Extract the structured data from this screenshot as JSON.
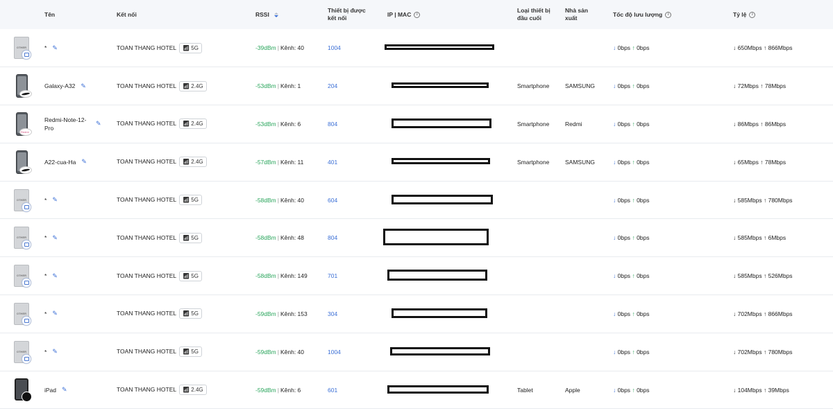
{
  "headers": {
    "name": "Tên",
    "connection": "Kết nối",
    "rssi": "RSSI",
    "connected_line1": "Thiết bị được",
    "connected_line2": "kết nối",
    "ipmac": "IP | MAC",
    "devtype_line1": "Loại thiết bị",
    "devtype_line2": "đầu cuối",
    "maker_line1": "Nhà sản",
    "maker_line2": "xuất",
    "throughput": "Tốc độ lưu lượng",
    "rate": "Tỷ lệ"
  },
  "colors": {
    "accent": "#3b6fd6",
    "green": "#2aa55c",
    "redaction": "#111111"
  },
  "rows": [
    {
      "icon": "other",
      "icon_label": "OTHER",
      "name": "*",
      "ssid": "TOAN THANG HOTEL",
      "band": "5G",
      "rssi": "-39dBm",
      "channel_label": "Kênh: 40",
      "connected": "1004",
      "devtype": "",
      "maker": "",
      "down": "0bps",
      "up": "0bps",
      "rate_down": "650Mbps",
      "rate_up": "866Mbps"
    },
    {
      "icon": "phone-samsung",
      "icon_label": "",
      "name": "Galaxy-A32",
      "ssid": "TOAN THANG HOTEL",
      "band": "2.4G",
      "rssi": "-53dBm",
      "channel_label": "Kênh: 1",
      "connected": "204",
      "devtype": "Smartphone",
      "maker": "SAMSUNG",
      "down": "0bps",
      "up": "0bps",
      "rate_down": "72Mbps",
      "rate_up": "78Mbps"
    },
    {
      "icon": "phone-redmi",
      "icon_label": "",
      "name": "Redmi-Note-12-Pro",
      "ssid": "TOAN THANG HOTEL",
      "band": "2.4G",
      "rssi": "-53dBm",
      "channel_label": "Kênh: 6",
      "connected": "804",
      "devtype": "Smartphone",
      "maker": "Redmi",
      "down": "0bps",
      "up": "0bps",
      "rate_down": "86Mbps",
      "rate_up": "86Mbps"
    },
    {
      "icon": "phone-samsung",
      "icon_label": "",
      "name": "A22-cua-Ha",
      "ssid": "TOAN THANG HOTEL",
      "band": "2.4G",
      "rssi": "-57dBm",
      "channel_label": "Kênh: 11",
      "connected": "401",
      "devtype": "Smartphone",
      "maker": "SAMSUNG",
      "down": "0bps",
      "up": "0bps",
      "rate_down": "65Mbps",
      "rate_up": "78Mbps"
    },
    {
      "icon": "other",
      "icon_label": "OTHER",
      "name": "*",
      "ssid": "TOAN THANG HOTEL",
      "band": "5G",
      "rssi": "-58dBm",
      "channel_label": "Kênh: 40",
      "connected": "604",
      "devtype": "",
      "maker": "",
      "down": "0bps",
      "up": "0bps",
      "rate_down": "585Mbps",
      "rate_up": "780Mbps"
    },
    {
      "icon": "other",
      "icon_label": "OTHER",
      "name": "*",
      "ssid": "TOAN THANG HOTEL",
      "band": "5G",
      "rssi": "-58dBm",
      "channel_label": "Kênh: 48",
      "connected": "804",
      "devtype": "",
      "maker": "",
      "down": "0bps",
      "up": "0bps",
      "rate_down": "585Mbps",
      "rate_up": "6Mbps"
    },
    {
      "icon": "other",
      "icon_label": "OTHER",
      "name": "*",
      "ssid": "TOAN THANG HOTEL",
      "band": "5G",
      "rssi": "-58dBm",
      "channel_label": "Kênh: 149",
      "connected": "701",
      "devtype": "",
      "maker": "",
      "down": "0bps",
      "up": "0bps",
      "rate_down": "585Mbps",
      "rate_up": "526Mbps"
    },
    {
      "icon": "other",
      "icon_label": "OTHER",
      "name": "*",
      "ssid": "TOAN THANG HOTEL",
      "band": "5G",
      "rssi": "-59dBm",
      "channel_label": "Kênh: 153",
      "connected": "304",
      "devtype": "",
      "maker": "",
      "down": "0bps",
      "up": "0bps",
      "rate_down": "702Mbps",
      "rate_up": "866Mbps"
    },
    {
      "icon": "other",
      "icon_label": "OTHER",
      "name": "*",
      "ssid": "TOAN THANG HOTEL",
      "band": "5G",
      "rssi": "-59dBm",
      "channel_label": "Kênh: 40",
      "connected": "1004",
      "devtype": "",
      "maker": "",
      "down": "0bps",
      "up": "0bps",
      "rate_down": "702Mbps",
      "rate_up": "780Mbps"
    },
    {
      "icon": "tablet-apple",
      "icon_label": "",
      "name": "iPad",
      "ssid": "TOAN THANG HOTEL",
      "band": "2.4G",
      "rssi": "-59dBm",
      "channel_label": "Kênh: 6",
      "connected": "601",
      "devtype": "Tablet",
      "maker": "Apple",
      "down": "0bps",
      "up": "0bps",
      "rate_down": "104Mbps",
      "rate_up": "39Mbps"
    }
  ]
}
